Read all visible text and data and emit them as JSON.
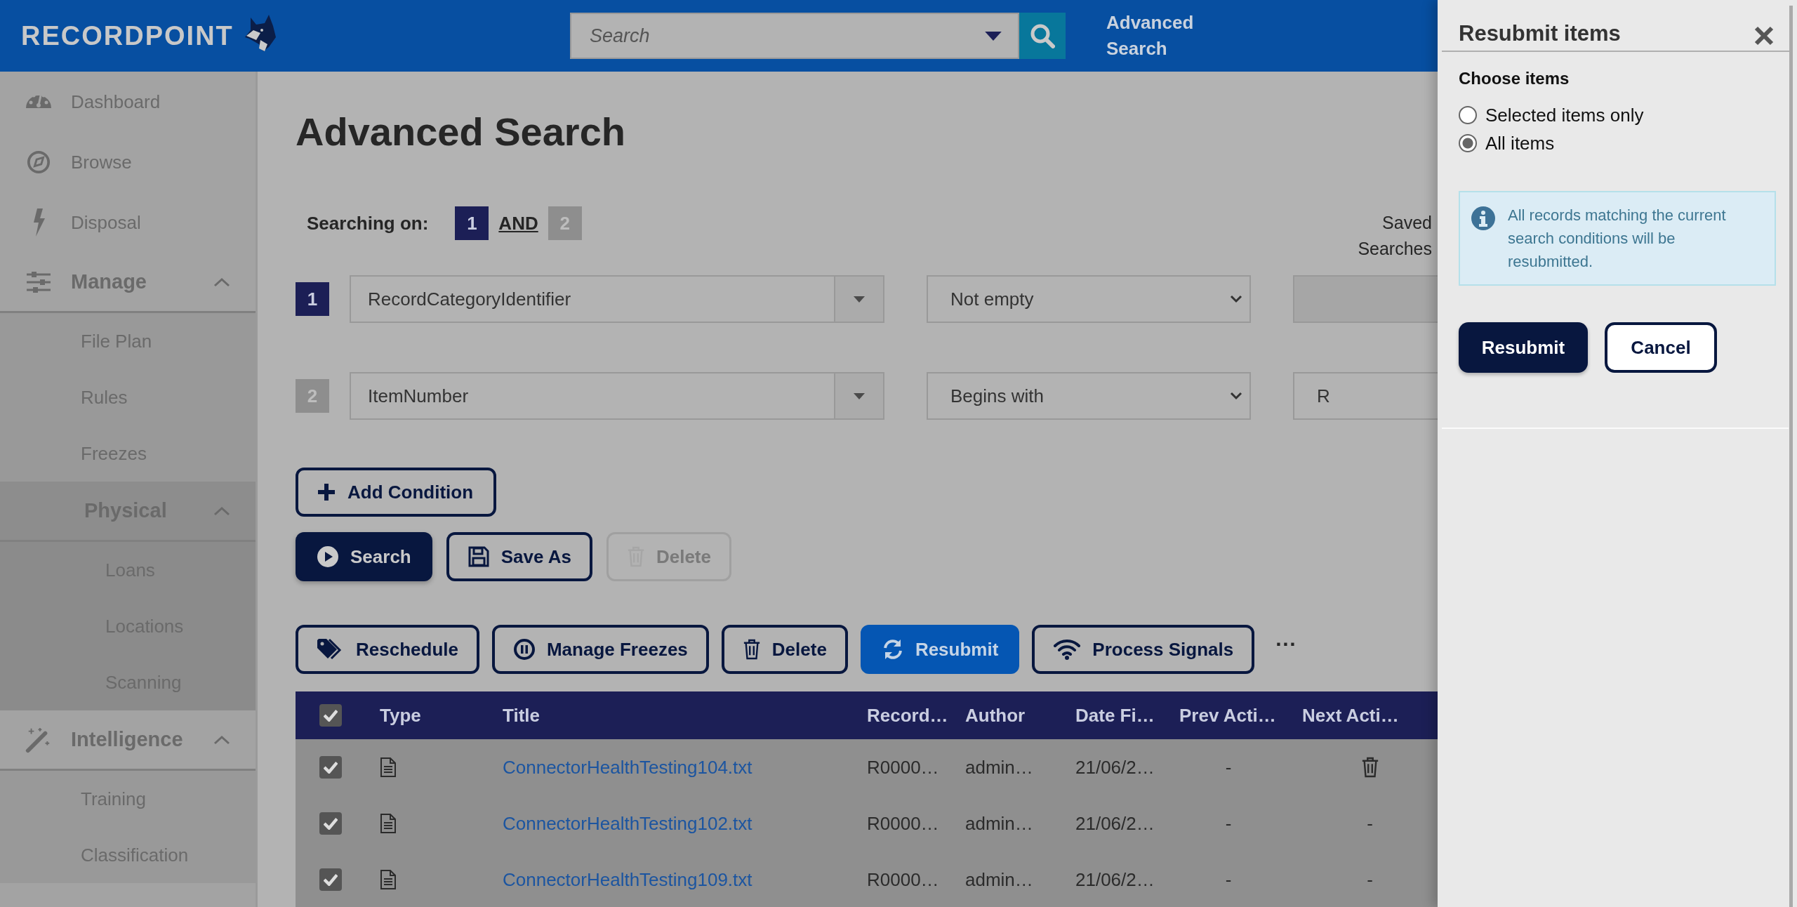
{
  "header": {
    "logo": "RECORDPOINT",
    "search": {
      "placeholder": "Search"
    },
    "advanced_search": "Advanced Search"
  },
  "sidebar": {
    "items": [
      {
        "label": "Dashboard"
      },
      {
        "label": "Browse"
      },
      {
        "label": "Disposal"
      },
      {
        "label": "Manage",
        "expanded": true,
        "children": [
          {
            "label": "File Plan"
          },
          {
            "label": "Rules"
          },
          {
            "label": "Freezes"
          },
          {
            "label": "Physical",
            "expanded": true,
            "children": [
              {
                "label": "Loans"
              },
              {
                "label": "Locations"
              },
              {
                "label": "Scanning"
              }
            ]
          }
        ]
      },
      {
        "label": "Intelligence",
        "expanded": true,
        "children": [
          {
            "label": "Training"
          },
          {
            "label": "Classification"
          }
        ]
      }
    ]
  },
  "main": {
    "title": "Advanced Search",
    "searching_on": {
      "label": "Searching on:",
      "badges": [
        {
          "text": "1",
          "selected": true
        },
        {
          "text": "2",
          "selected": false
        }
      ],
      "join": "AND"
    },
    "saved_searches": "Saved Searches",
    "conditions": [
      {
        "number": "1",
        "selected": true,
        "field": "RecordCategoryIdentifier",
        "operator": "Not empty",
        "value_disabled": true
      },
      {
        "number": "2",
        "selected": false,
        "field": "ItemNumber",
        "operator": "Begins with",
        "value": "R",
        "value_disabled": false
      }
    ],
    "add_condition": "Add Condition",
    "search_buttons": [
      {
        "label": "Search",
        "kind": "primary",
        "disabled": false
      },
      {
        "label": "Save As",
        "kind": "outline",
        "disabled": false
      },
      {
        "label": "Delete",
        "kind": "outline",
        "disabled": true
      }
    ],
    "actions": [
      {
        "label": "Reschedule",
        "selected": false
      },
      {
        "label": "Manage Freezes",
        "selected": false
      },
      {
        "label": "Delete",
        "selected": false
      },
      {
        "label": "Resubmit",
        "selected": true
      },
      {
        "label": "Process Signals",
        "selected": false
      }
    ],
    "more": "···",
    "table": {
      "header_checked": true,
      "columns": [
        "Type",
        "Title",
        "Record…",
        "Author",
        "Date Fi…",
        "Prev Acti…",
        "Next Acti…"
      ],
      "rows": [
        {
          "checked": true,
          "title": "ConnectorHealthTesting104.txt",
          "record": "R0000…",
          "author": "admin…",
          "date": "21/06/2…",
          "prev_action": "-",
          "next_action": {
            "kind": "icon"
          }
        },
        {
          "checked": true,
          "title": "ConnectorHealthTesting102.txt",
          "record": "R0000…",
          "author": "admin…",
          "date": "21/06/2…",
          "prev_action": "-",
          "next_action": {
            "kind": "text",
            "text": "-"
          }
        },
        {
          "checked": true,
          "title": "ConnectorHealthTesting109.txt",
          "record": "R0000…",
          "author": "admin…",
          "date": "21/06/2…",
          "prev_action": "-",
          "next_action": {
            "kind": "text",
            "text": "-"
          }
        }
      ]
    }
  },
  "panel": {
    "title": "Resubmit items",
    "section": "Choose items",
    "options": [
      {
        "label": "Selected items only",
        "selected": false
      },
      {
        "label": "All items",
        "selected": true
      }
    ],
    "info": "All records matching the current search conditions will be resubmitted.",
    "buttons": [
      {
        "label": "Resubmit",
        "kind": "primary"
      },
      {
        "label": "Cancel",
        "kind": "secondary"
      }
    ]
  }
}
